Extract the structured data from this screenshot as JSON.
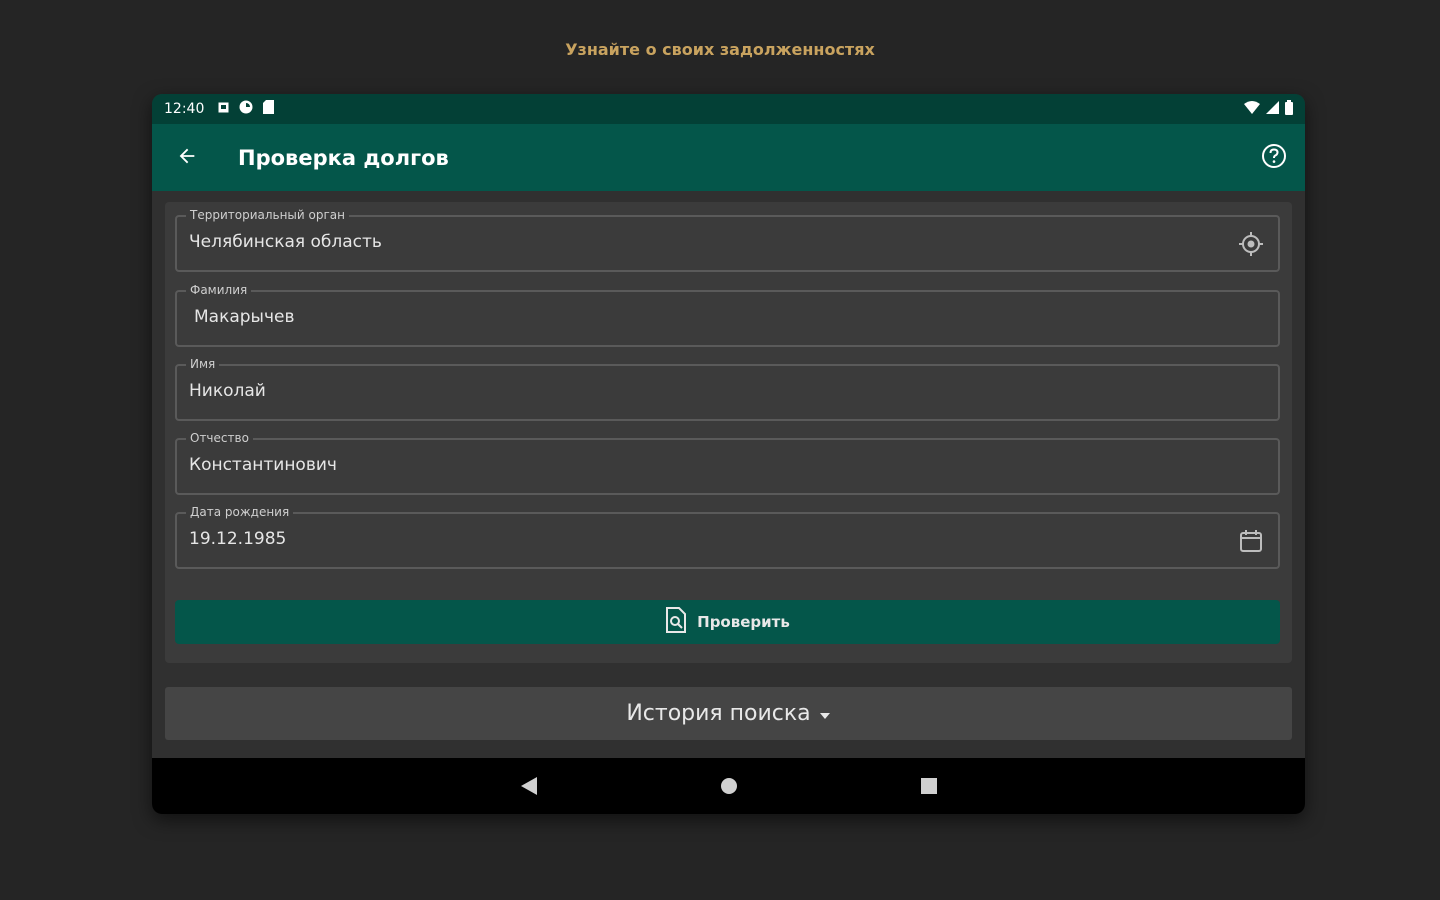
{
  "promo": {
    "text": "Узнайте о своих задолженностях"
  },
  "statusbar": {
    "time": "12:40"
  },
  "appbar": {
    "title": "Проверка долгов"
  },
  "form": {
    "territory": {
      "label": "Территориальный орган",
      "value": "Челябинская область"
    },
    "lastname": {
      "label": "Фамилия",
      "value": "Макарычев"
    },
    "firstname": {
      "label": "Имя",
      "value": "Николай"
    },
    "patronymic": {
      "label": "Отчество",
      "value": "Константинович"
    },
    "birthdate": {
      "label": "Дата рождения",
      "value": "19.12.1985"
    }
  },
  "check_button": {
    "label": "Проверить"
  },
  "history": {
    "label": "История поиска"
  },
  "colors": {
    "background": "#252525",
    "statusbar": "#034036",
    "appbar": "#04564a",
    "accent_text": "#c9a35f"
  },
  "icons": {
    "back": "arrow-left-icon",
    "help": "help-circle-icon",
    "location": "location-target-icon",
    "calendar": "calendar-icon",
    "document_search": "document-search-icon",
    "dropdown": "caret-down-icon"
  }
}
